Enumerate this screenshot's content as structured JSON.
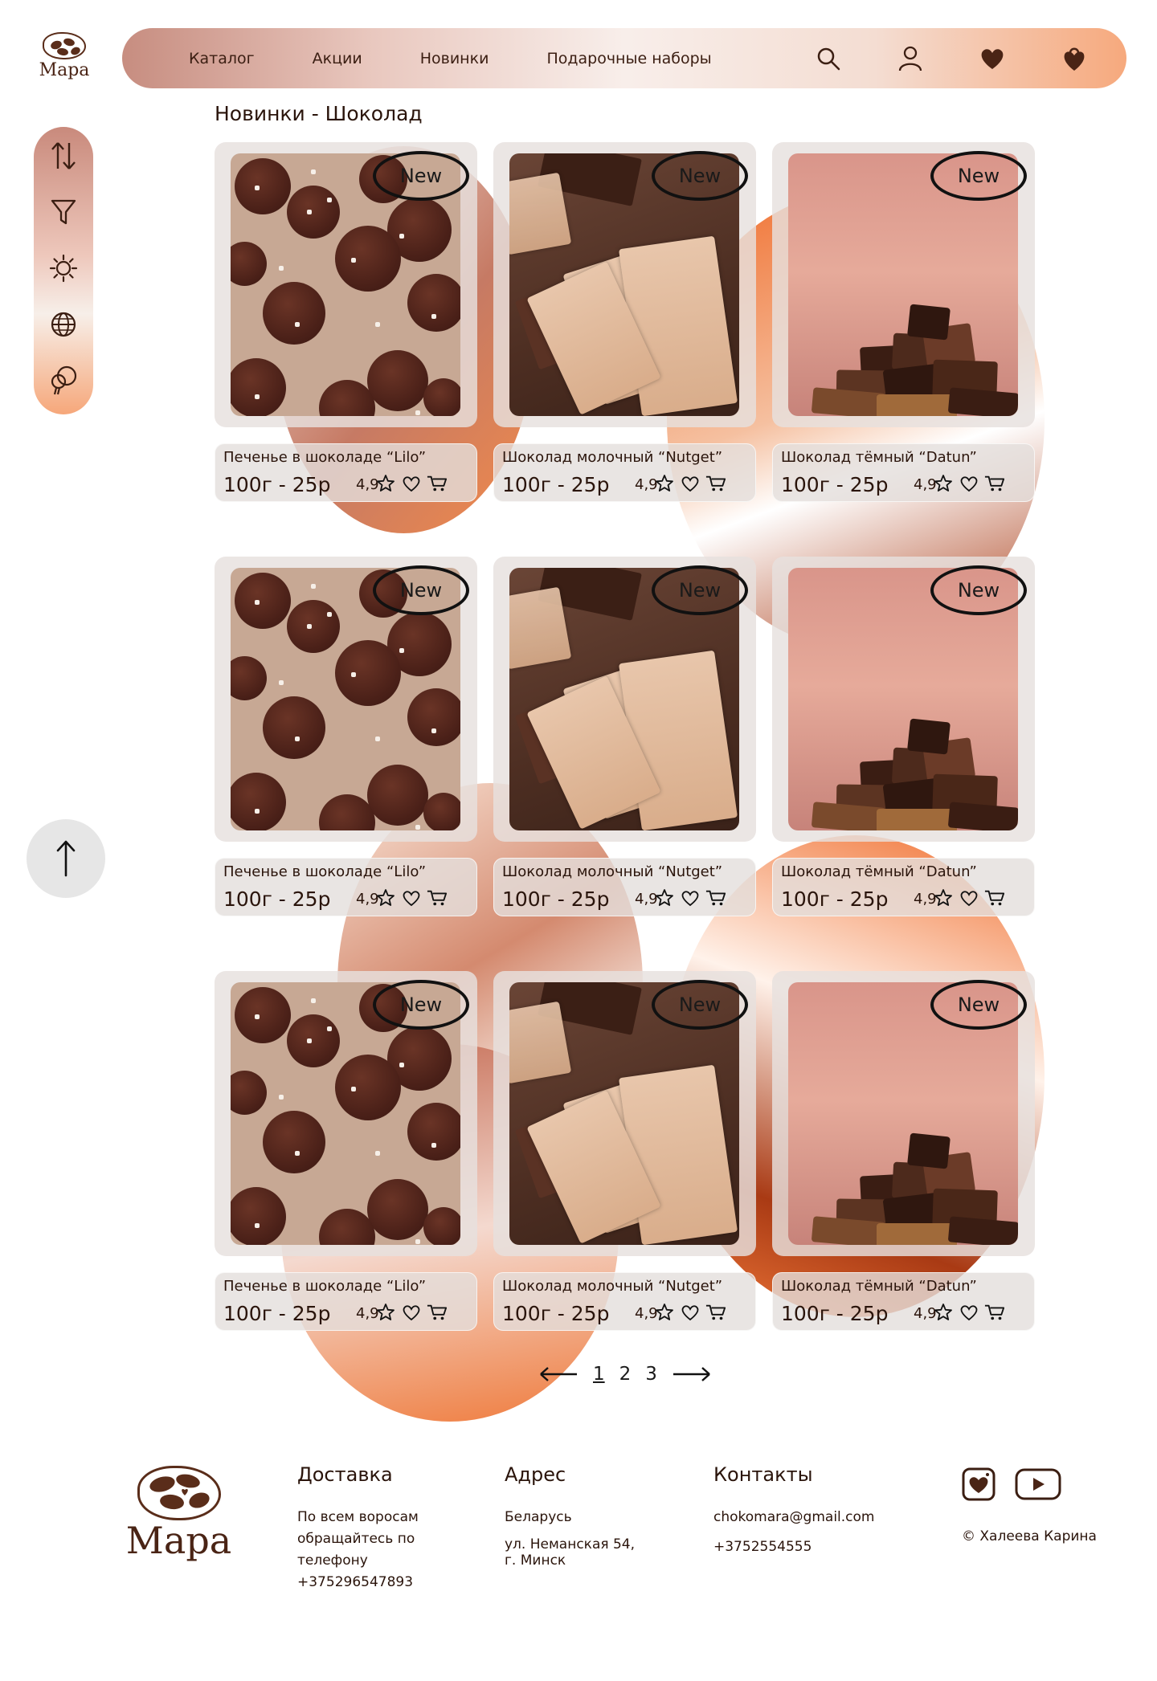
{
  "brand": {
    "name": "Мара"
  },
  "nav": {
    "items": [
      "Каталог",
      "Акции",
      "Новинки",
      "Подарочные наборы"
    ],
    "icons": [
      "search-icon",
      "user-icon",
      "favorites-heart-icon",
      "cart-bag-icon"
    ]
  },
  "page": {
    "title": "Новинки - Шоколад"
  },
  "sidebar": {
    "icons": [
      "sort-icon",
      "filter-icon",
      "theme-sun-icon",
      "language-globe-icon",
      "ideas-bulb-icon"
    ]
  },
  "products": [
    {
      "name": "Печенье в шоколаде “Lilo”",
      "price": "100г - 25р",
      "rating": "4,9",
      "badge": "New",
      "image": "cookies"
    },
    {
      "name": "Шоколад молочный “Nutget”",
      "price": "100г - 25р",
      "rating": "4,9",
      "badge": "New",
      "image": "chocolate-bars"
    },
    {
      "name": "Шоколад тёмный “Datun”",
      "price": "100г - 25р",
      "rating": "4,9",
      "badge": "New",
      "image": "chocolate-pile"
    },
    {
      "name": "Печенье в шоколаде “Lilo”",
      "price": "100г - 25р",
      "rating": "4,9",
      "badge": "New",
      "image": "cookies"
    },
    {
      "name": "Шоколад молочный “Nutget”",
      "price": "100г - 25р",
      "rating": "4,9",
      "badge": "New",
      "image": "chocolate-bars"
    },
    {
      "name": "Шоколад тёмный “Datun”",
      "price": "100г - 25р",
      "rating": "4,9",
      "badge": "New",
      "image": "chocolate-pile"
    },
    {
      "name": "Печенье в шоколаде “Lilo”",
      "price": "100г - 25р",
      "rating": "4,9",
      "badge": "New",
      "image": "cookies"
    },
    {
      "name": "Шоколад молочный “Nutget”",
      "price": "100г - 25р",
      "rating": "4,9",
      "badge": "New",
      "image": "chocolate-bars"
    },
    {
      "name": "Шоколад тёмный “Datun”",
      "price": "100г - 25р",
      "rating": "4,9",
      "badge": "New",
      "image": "chocolate-pile"
    }
  ],
  "pagination": {
    "pages": [
      "1",
      "2",
      "3"
    ],
    "current": "1"
  },
  "footer": {
    "delivery": {
      "title": "Доставка",
      "lines": [
        "По всем воросам",
        "обращайтесь по",
        "телефону",
        "+375296547893"
      ]
    },
    "address": {
      "title": "Адрес",
      "country": "Беларусь",
      "street": "ул. Неманская 54,",
      "city": "г. Минск"
    },
    "contacts": {
      "title": "Контакты",
      "email": "chokomara@gmail.com",
      "phone": "+3752554555"
    },
    "social": [
      "instagram-icon",
      "youtube-icon"
    ],
    "copyright": "© Халеева Карина"
  },
  "colors": {
    "accent": "#f06c2a",
    "brand_brown": "#4a2415",
    "soft_pink": "#e9c8bf"
  }
}
